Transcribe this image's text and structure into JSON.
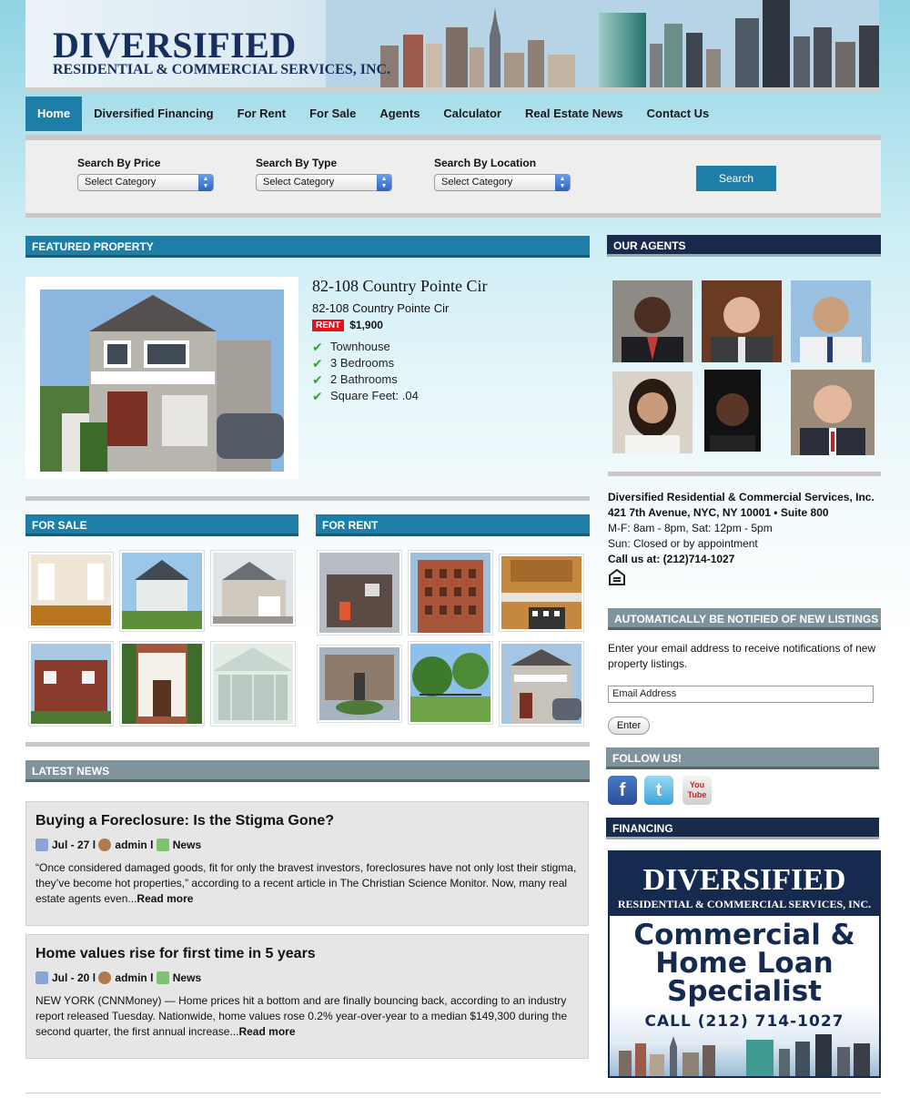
{
  "brand": {
    "name": "DIVERSIFIED",
    "tagline": "RESIDENTIAL & COMMERCIAL SERVICES, INC."
  },
  "nav": {
    "items": [
      {
        "label": "Home",
        "active": true
      },
      {
        "label": "Diversified Financing"
      },
      {
        "label": "For Rent"
      },
      {
        "label": "For Sale"
      },
      {
        "label": "Agents"
      },
      {
        "label": "Calculator"
      },
      {
        "label": "Real Estate News"
      },
      {
        "label": "Contact Us"
      }
    ]
  },
  "search": {
    "price_label": "Search By Price",
    "type_label": "Search By Type",
    "location_label": "Search By Location",
    "price_value": "Select Category",
    "type_value": "Select Category",
    "location_value": "Select Category",
    "button": "Search"
  },
  "featured": {
    "heading": "FEATURED PROPERTY",
    "title": "82-108 Country Pointe Cir",
    "address": "82-108 Country Pointe Cir",
    "badge": "RENT",
    "price": "$1,900",
    "features": [
      "Townhouse",
      "3 Bedrooms",
      "2 Bathrooms",
      "Square Feet: .04"
    ]
  },
  "for_sale": {
    "heading": "FOR SALE"
  },
  "for_rent": {
    "heading": "FOR RENT"
  },
  "news": {
    "heading": "LATEST NEWS",
    "items": [
      {
        "title": "Buying a Foreclosure: Is the Stigma Gone?",
        "date": "Jul - 27",
        "author": "admin",
        "category": "News",
        "excerpt": "“Once considered damaged goods, fit for only the bravest investors, foreclosures have not only lost their stigma, they’ve become hot properties,” according to a recent article in The Christian Science Monitor. Now, many real estate agents even...",
        "more": "Read more"
      },
      {
        "title": "Home values rise for first time in 5 years",
        "date": "Jul - 20",
        "author": "admin",
        "category": "News",
        "excerpt": "NEW YORK (CNNMoney) — Home prices hit a bottom and are finally bouncing back, according to an industry report released Tuesday. Nationwide, home values rose 0.2% year-over-year to a median $149,300 during the second quarter, the first annual increase...",
        "more": "Read more"
      }
    ],
    "separator": "l"
  },
  "sidebar": {
    "agents_heading": "OUR AGENTS",
    "company": "Diversified Residential & Commercial Services, Inc.",
    "address": "421 7th Avenue, NYC, NY 10001 • Suite 800",
    "hours1": "M-F: 8am - 8pm, Sat: 12pm - 5pm",
    "hours2": "Sun: Closed or by appointment",
    "phone": "Call us at: (212)714-1027",
    "notify_heading": "AUTOMATICALLY BE NOTIFIED OF NEW LISTINGS",
    "notify_text": "Enter your email address to receive notifications of new property listings.",
    "email_value": "Email Address",
    "enter_button": "Enter",
    "follow_heading": "FOLLOW US!",
    "financing_heading": "FINANCING",
    "ad": {
      "brand": "DIVERSIFIED",
      "sub": "RESIDENTIAL & COMMERCIAL SERVICES, INC.",
      "line1": "Commercial &",
      "line2": "Home Loan",
      "line3": "Specialist",
      "call": "CALL (212) 714-1027"
    }
  },
  "icons": {
    "facebook": "f",
    "twitter": "t",
    "youtube": "You Tube"
  },
  "colors": {
    "accent": "#1d7fa7",
    "navy": "#1a2a4a",
    "rent_badge": "#e4121c"
  }
}
